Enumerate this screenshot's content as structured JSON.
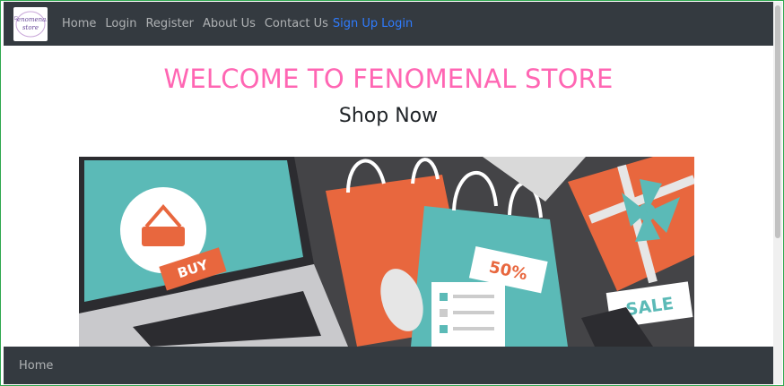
{
  "navbar": {
    "brand_line1": "Fenomenal",
    "brand_line2": "store",
    "links": [
      "Home",
      "Login",
      "Register",
      "About Us",
      "Contact Us"
    ],
    "signup_label": "Sign Up",
    "login_label": "Login"
  },
  "main": {
    "heading": "WELCOME TO FENOMENAL STORE",
    "subheading": "Shop Now",
    "hero": {
      "buy_label": "BUY",
      "discount_label": "50%",
      "sale_label": "SALE"
    }
  },
  "footer": {
    "link": "Home"
  },
  "colors": {
    "navbar_bg": "#343a40",
    "heading": "#ff66b3",
    "accent_link": "#2f7cff"
  }
}
